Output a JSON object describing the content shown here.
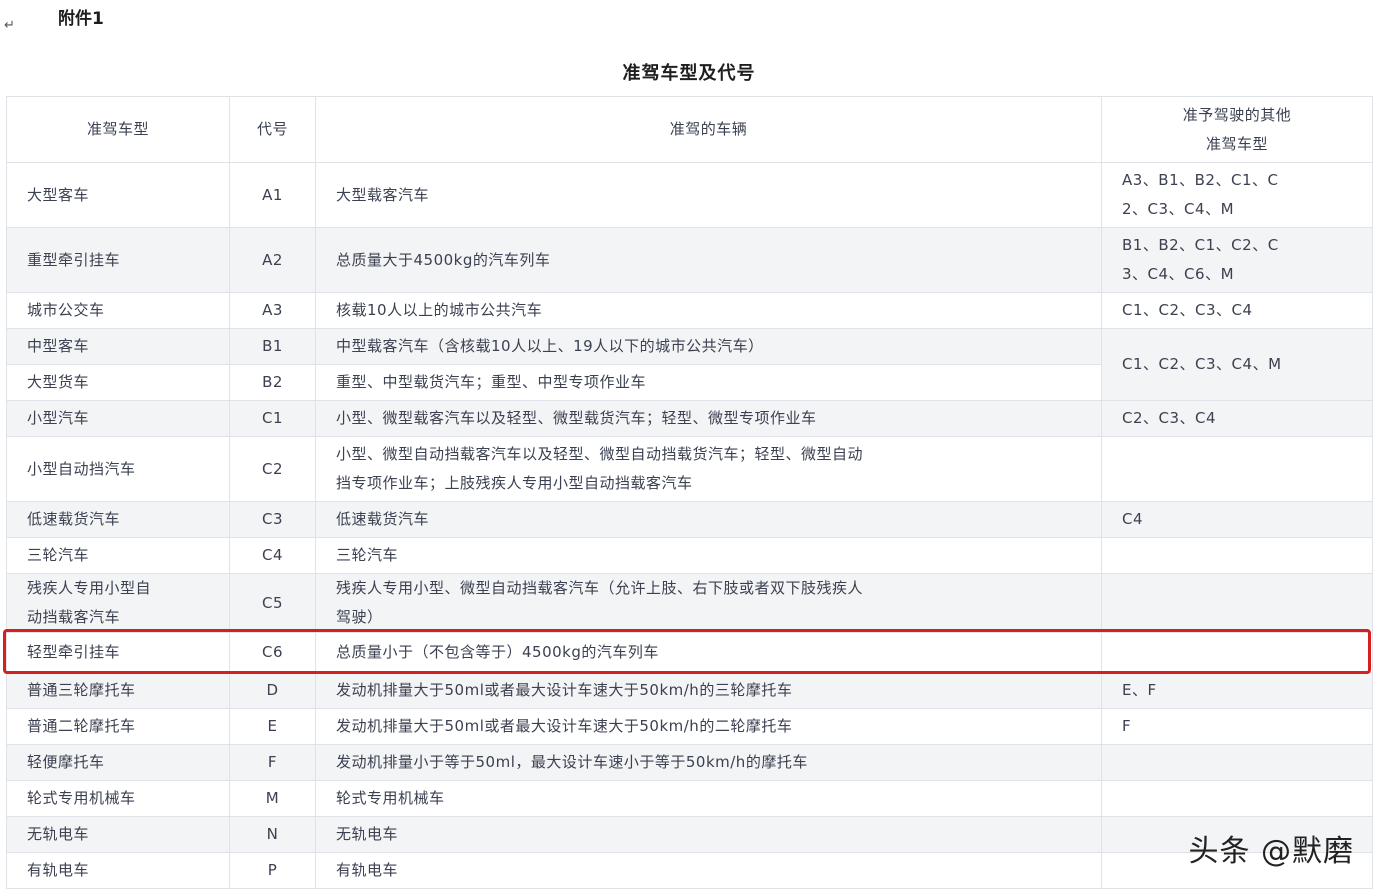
{
  "attachment_label": "附件1",
  "return_symbol": "↵",
  "title": "准驾车型及代号",
  "headers": {
    "type": "准驾车型",
    "code": "代号",
    "vehicles": "准驾的车辆",
    "others_line1": "准予驾驶的其他",
    "others_line2": "准驾车型"
  },
  "rows": [
    {
      "type_lines": [
        "大型客车"
      ],
      "code": "A1",
      "vehicles_lines": [
        "大型载客汽车"
      ],
      "others_lines": [
        "A3、B1、B2、C1、C",
        "2、C3、C4、M"
      ]
    },
    {
      "type_lines": [
        "重型牵引挂车"
      ],
      "code": "A2",
      "vehicles_lines": [
        "总质量大于4500kg的汽车列车"
      ],
      "others_lines": [
        "B1、B2、C1、C2、C",
        "3、C4、C6、M"
      ]
    },
    {
      "type_lines": [
        "城市公交车"
      ],
      "code": "A3",
      "vehicles_lines": [
        "核载10人以上的城市公共汽车"
      ],
      "others_lines": [
        "C1、C2、C3、C4"
      ]
    },
    {
      "type_lines": [
        "中型客车"
      ],
      "code": "B1",
      "vehicles_lines": [
        "中型载客汽车（含核载10人以上、19人以下的城市公共汽车）"
      ]
    },
    {
      "type_lines": [
        "大型货车"
      ],
      "code": "B2",
      "vehicles_lines": [
        "重型、中型载货汽车；重型、中型专项作业车"
      ]
    },
    {
      "type_lines": [
        "小型汽车"
      ],
      "code": "C1",
      "vehicles_lines": [
        "小型、微型载客汽车以及轻型、微型载货汽车；轻型、微型专项作业车"
      ],
      "others_lines": [
        "C2、C3、C4"
      ]
    },
    {
      "type_lines": [
        "小型自动挡汽车"
      ],
      "code": "C2",
      "vehicles_lines": [
        "小型、微型自动挡载客汽车以及轻型、微型自动挡载货汽车；轻型、微型自动",
        "挡专项作业车；上肢残疾人专用小型自动挡载客汽车"
      ],
      "others_lines": []
    },
    {
      "type_lines": [
        "低速载货汽车"
      ],
      "code": "C3",
      "vehicles_lines": [
        "低速载货汽车"
      ],
      "others_lines": [
        "C4"
      ]
    },
    {
      "type_lines": [
        "三轮汽车"
      ],
      "code": "C4",
      "vehicles_lines": [
        "三轮汽车"
      ],
      "others_lines": []
    },
    {
      "type_lines": [
        "残疾人专用小型自",
        "动挡载客汽车"
      ],
      "code": "C5",
      "vehicles_lines": [
        "残疾人专用小型、微型自动挡载客汽车（允许上肢、右下肢或者双下肢残疾人",
        "驾驶）"
      ],
      "others_lines": []
    },
    {
      "type_lines": [
        "轻型牵引挂车"
      ],
      "code": "C6",
      "vehicles_lines": [
        "总质量小于（不包含等于）4500kg的汽车列车"
      ],
      "others_lines": []
    },
    {
      "type_lines": [
        "普通三轮摩托车"
      ],
      "code": "D",
      "vehicles_lines": [
        "发动机排量大于50ml或者最大设计车速大于50km/h的三轮摩托车"
      ],
      "others_lines": [
        "E、F"
      ]
    },
    {
      "type_lines": [
        "普通二轮摩托车"
      ],
      "code": "E",
      "vehicles_lines": [
        "发动机排量大于50ml或者最大设计车速大于50km/h的二轮摩托车"
      ],
      "others_lines": [
        "F"
      ]
    },
    {
      "type_lines": [
        "轻便摩托车"
      ],
      "code": "F",
      "vehicles_lines": [
        "发动机排量小于等于50ml，最大设计车速小于等于50km/h的摩托车"
      ],
      "others_lines": []
    },
    {
      "type_lines": [
        "轮式专用机械车"
      ],
      "code": "M",
      "vehicles_lines": [
        "轮式专用机械车"
      ],
      "others_lines": []
    },
    {
      "type_lines": [
        "无轨电车"
      ],
      "code": "N",
      "vehicles_lines": [
        "无轨电车"
      ],
      "others_lines": []
    },
    {
      "type_lines": [
        "有轨电车"
      ],
      "code": "P",
      "vehicles_lines": [
        "有轨电车"
      ],
      "others_lines": []
    }
  ],
  "merged_others_b1_b2": "C1、C2、C3、C4、M",
  "highlight_color": "#d42020",
  "watermark": "头条 @默磨"
}
